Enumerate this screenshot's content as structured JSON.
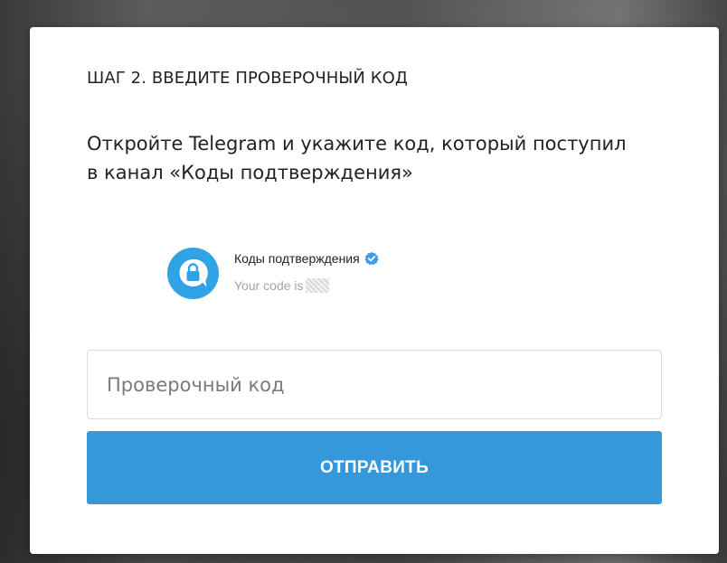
{
  "modal": {
    "step_title": "ШАГ 2. ВВЕДИТЕ ПРОВЕРОЧНЫЙ КОД",
    "instruction": "Откройте Telegram и укажите код, который поступил в канал «Коды подтверждения»"
  },
  "channel_preview": {
    "avatar_icon": "lock-icon",
    "verified_icon": "verified-badge-icon",
    "name": "Коды подтверждения",
    "message_prefix": "Your code is"
  },
  "code_input": {
    "value": "",
    "placeholder": "Проверочный код"
  },
  "submit": {
    "label": "ОТПРАВИТЬ"
  },
  "colors": {
    "accent": "#3498db",
    "avatar": "#2fa3e6",
    "verified": "#3d9ae8"
  }
}
